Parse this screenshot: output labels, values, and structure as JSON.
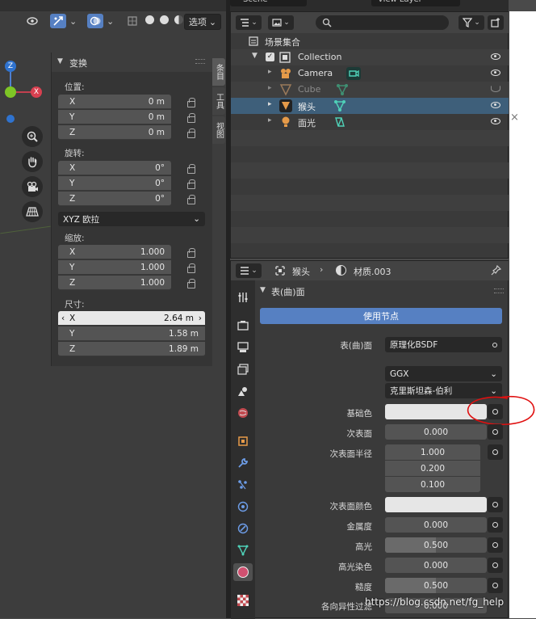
{
  "viewport": {
    "select_label": "选项",
    "npanel": {
      "title": "变换",
      "location_label": "位置:",
      "location": [
        {
          "axis": "X",
          "value": "0 m"
        },
        {
          "axis": "Y",
          "value": "0 m"
        },
        {
          "axis": "Z",
          "value": "0 m"
        }
      ],
      "rotation_label": "旋转:",
      "rotation": [
        {
          "axis": "X",
          "value": "0°"
        },
        {
          "axis": "Y",
          "value": "0°"
        },
        {
          "axis": "Z",
          "value": "0°"
        }
      ],
      "rotation_mode": "XYZ 欧拉",
      "scale_label": "缩放:",
      "scale": [
        {
          "axis": "X",
          "value": "1.000"
        },
        {
          "axis": "Y",
          "value": "1.000"
        },
        {
          "axis": "Z",
          "value": "1.000"
        }
      ],
      "dimensions_label": "尺寸:",
      "dimensions": [
        {
          "axis": "X",
          "value": "2.64 m"
        },
        {
          "axis": "Y",
          "value": "1.58 m"
        },
        {
          "axis": "Z",
          "value": "1.89 m"
        }
      ]
    },
    "tabs": [
      "条目",
      "工具",
      "视图"
    ],
    "gizmo": {
      "x": "X",
      "y": "Y",
      "z": "Z"
    }
  },
  "top_bar": {
    "scene": "Scene",
    "view_layer": "View Layer"
  },
  "outliner": {
    "scene_collection": "场景集合",
    "collection": "Collection",
    "items": [
      {
        "name": "Camera",
        "hidden": false,
        "selected": false
      },
      {
        "name": "Cube",
        "hidden": true,
        "selected": false
      },
      {
        "name": "猴头",
        "hidden": false,
        "selected": true
      },
      {
        "name": "面光",
        "hidden": false,
        "selected": false
      }
    ]
  },
  "properties": {
    "breadcrumb_object": "猴头",
    "breadcrumb_material": "材质.003",
    "section": "表(曲)面",
    "use_nodes": "使用节点",
    "surface_label": "表(曲)面",
    "surface_value": "原理化BSDF",
    "distribution": "GGX",
    "subsurface_method": "克里斯坦森-伯利",
    "base_color_label": "基础色",
    "subsurface_label": "次表面",
    "subsurface_value": "0.000",
    "subsurface_radius_label": "次表面半径",
    "subsurface_radius": [
      "1.000",
      "0.200",
      "0.100"
    ],
    "subsurface_color_label": "次表面颜色",
    "metallic_label": "金属度",
    "metallic_value": "0.000",
    "specular_label": "高光",
    "specular_value": "0.500",
    "specular_fill": 0.5,
    "specular_tint_label": "高光染色",
    "specular_tint_value": "0.000",
    "roughness_label": "糙度",
    "roughness_value": "0.500",
    "roughness_fill": 0.5,
    "anisotropic_label": "各向异性过滤",
    "anisotropic_value": "0.000"
  },
  "watermark": "https://blog.csdn.net/fg_help",
  "colors": {
    "selection": "#3e5f7a",
    "accent": "#5680c2",
    "annotation": "#e01010"
  }
}
